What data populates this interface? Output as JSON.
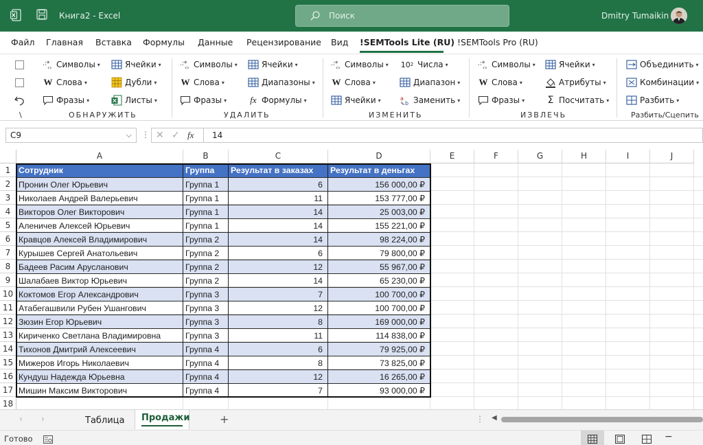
{
  "titlebar": {
    "doc_title": "Книга2  -  Excel",
    "search_placeholder": "Поиск",
    "user_name": "Dmitry Tumaikin",
    "accent": "#217346"
  },
  "menu": {
    "tabs": [
      "Файл",
      "Главная",
      "Вставка",
      "Формулы",
      "Данные",
      "Рецензирование",
      "Вид",
      "!SEMTools Lite (RU)",
      "!SEMTools Pro (RU)"
    ],
    "active": "!SEMTools Lite (RU)"
  },
  "ribbon": {
    "misc": {
      "backslash": "\\"
    },
    "groups": [
      {
        "label": "ОБНАРУЖИТЬ",
        "buttons": [
          "Символы",
          "Ячейки",
          "Слова",
          "Дубли",
          "Фразы",
          "Листы"
        ]
      },
      {
        "label": "УДАЛИТЬ",
        "buttons": [
          "Символы",
          "Ячейки",
          "Слова",
          "Диапазоны",
          "Фразы",
          "Формулы"
        ]
      },
      {
        "label": "ИЗМЕНИТЬ",
        "buttons": [
          "Символы",
          "Числа",
          "Слова",
          "Диапазон",
          "Ячейки",
          "Заменить"
        ]
      },
      {
        "label": "ИЗВЛЕЧЬ",
        "buttons": [
          "Символы",
          "Ячейки",
          "Слова",
          "Атрибуты",
          "Фразы",
          "Посчитать"
        ]
      },
      {
        "label": "Разбить/Сцепить",
        "buttons": [
          "Объединить",
          "Комбинации",
          "Разбить"
        ]
      }
    ],
    "chisla_sup": "10",
    "chisla_exp": "2"
  },
  "formula_bar": {
    "name_box": "C9",
    "fx": "fx",
    "value": "14"
  },
  "sheet": {
    "columns": [
      "A",
      "B",
      "C",
      "D",
      "E",
      "F",
      "G",
      "H",
      "I",
      "J"
    ],
    "rows": [
      "1",
      "2",
      "3",
      "4",
      "5",
      "6",
      "7",
      "8",
      "9",
      "10",
      "11",
      "12",
      "13",
      "14",
      "15",
      "16",
      "17",
      "18"
    ],
    "header": [
      "Сотрудник",
      "Группа",
      "Результат в заказах",
      "Результат в деньгах"
    ],
    "data": [
      [
        "Пронин Олег Юрьевич",
        "Группа 1",
        "6",
        "156 000,00 ₽"
      ],
      [
        "Николаев Андрей Валерьевич",
        "Группа 1",
        "11",
        "153 777,00 ₽"
      ],
      [
        "Викторов Олег Викторович",
        "Группа 1",
        "14",
        "25 003,00 ₽"
      ],
      [
        "Аленичев Алексей Юрьевич",
        "Группа 1",
        "14",
        "155 221,00 ₽"
      ],
      [
        "Кравцов Алексей Владимирович",
        "Группа 2",
        "14",
        "98 224,00 ₽"
      ],
      [
        "Курышев Сергей Анатольевич",
        "Группа 2",
        "6",
        "79 800,00 ₽"
      ],
      [
        "Бадеев  Расим Арусланович",
        "Группа 2",
        "12",
        "55 967,00 ₽"
      ],
      [
        "Шалабаев Виктор Юрьевич",
        "Группа 2",
        "14",
        "65 230,00 ₽"
      ],
      [
        "Коктомов Егор Александрович",
        "Группа 3",
        "7",
        "100 700,00 ₽"
      ],
      [
        "Атабегашвили Рубен Ушангович",
        "Группа 3",
        "12",
        "100 700,00 ₽"
      ],
      [
        "Зюзин Егор Юрьевич",
        "Группа 3",
        "8",
        "169 000,00 ₽"
      ],
      [
        "Кириченко Светлана Владимировна",
        "Группа 3",
        "11",
        "114 838,00 ₽"
      ],
      [
        "Тихонов Дмитрий Алексеевич",
        "Группа 4",
        "6",
        "79 925,00 ₽"
      ],
      [
        "Мижеров Игорь Николаевич",
        "Группа 4",
        "8",
        "73 825,00 ₽"
      ],
      [
        "Кундуш Надежда Юрьевна",
        "Группа 4",
        "12",
        "16 265,00 ₽"
      ],
      [
        "Мишин Максим Викторович",
        "Группа 4",
        "7",
        "93 000,00 ₽"
      ]
    ],
    "colors": {
      "header_bg": "#4472c4",
      "band_bg": "#d9e1f2",
      "header_text": "#ffffff"
    }
  },
  "sheet_tabs": {
    "tabs": [
      "Таблица",
      "Продажи"
    ],
    "active": "Продажи",
    "add": "+"
  },
  "status": {
    "text": "Готово"
  }
}
